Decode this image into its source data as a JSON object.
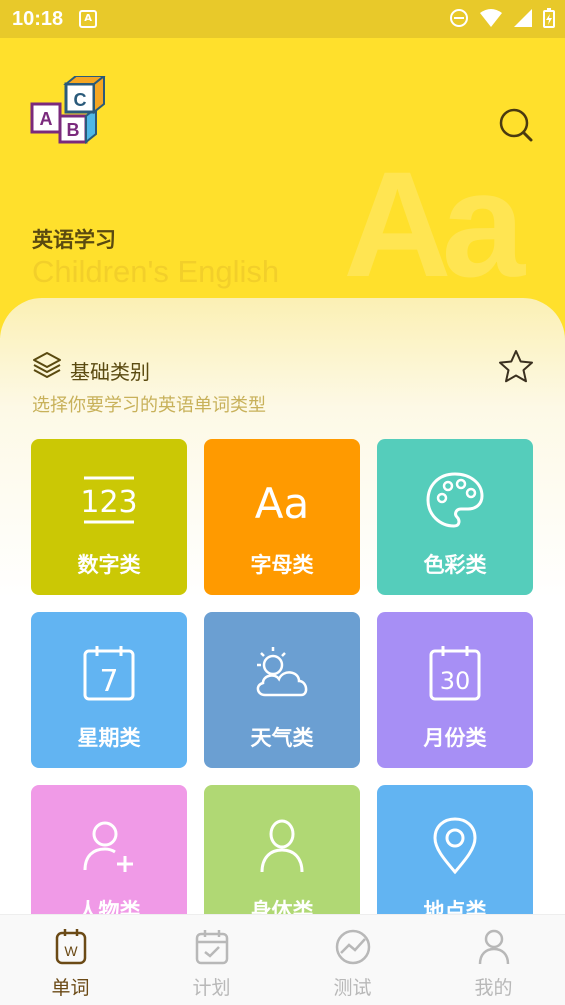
{
  "status_bar": {
    "time": "10:18",
    "notification_badge": "A"
  },
  "header": {
    "title": "英语学习",
    "subtitle": "Children's English",
    "watermark": "Aa",
    "logo_letters": [
      "A",
      "B",
      "C"
    ]
  },
  "section": {
    "title": "基础类别",
    "description": "选择你要学习的英语单词类型"
  },
  "categories": [
    {
      "label": "数字类",
      "icon": "numbers-icon",
      "icon_text": "123",
      "color": "#cbc805"
    },
    {
      "label": "字母类",
      "icon": "letters-icon",
      "icon_text": "Aa",
      "color": "#ff9a00"
    },
    {
      "label": "色彩类",
      "icon": "palette-icon",
      "color": "#55cdbb"
    },
    {
      "label": "星期类",
      "icon": "calendar-icon",
      "icon_text": "7",
      "color": "#62b4f2"
    },
    {
      "label": "天气类",
      "icon": "weather-icon",
      "color": "#6b9fd2"
    },
    {
      "label": "月份类",
      "icon": "month-calendar-icon",
      "icon_text": "30",
      "color": "#a78ff5"
    },
    {
      "label": "人物类",
      "icon": "add-person-icon",
      "color": "#f09ae7"
    },
    {
      "label": "身体类",
      "icon": "person-icon",
      "color": "#b0d874"
    },
    {
      "label": "地点类",
      "icon": "location-pin-icon",
      "color": "#62b4f2"
    }
  ],
  "tabs": [
    {
      "label": "单词",
      "icon": "words-icon",
      "icon_text": "W",
      "active": true
    },
    {
      "label": "计划",
      "icon": "plan-calendar-icon",
      "active": false
    },
    {
      "label": "测试",
      "icon": "test-chart-icon",
      "active": false
    },
    {
      "label": "我的",
      "icon": "profile-icon",
      "active": false
    }
  ],
  "colors": {
    "status_bar": "#e8c92a",
    "header": "#ffe02c",
    "accent_text": "#5a4a10",
    "tab_active": "#6b4a16",
    "tab_inactive": "#b8b8b8"
  }
}
